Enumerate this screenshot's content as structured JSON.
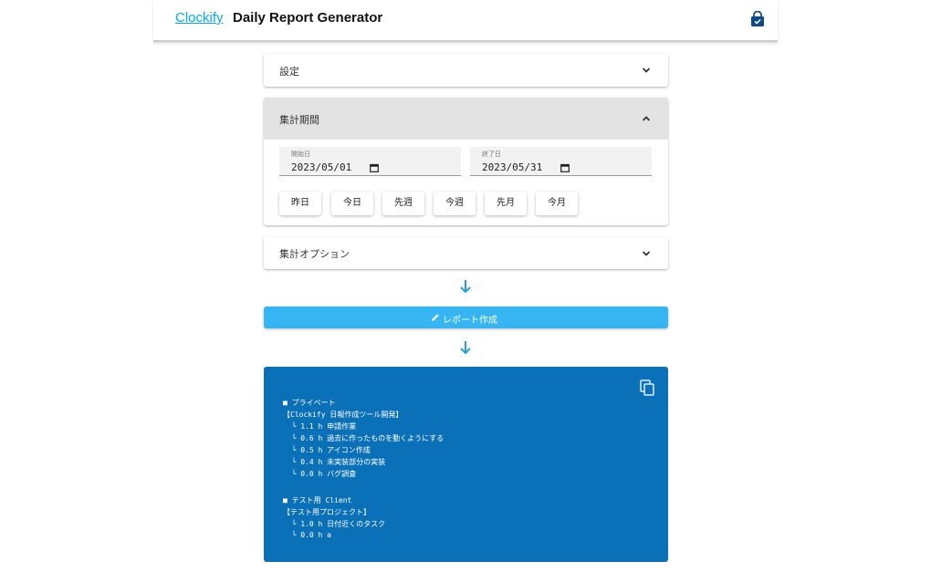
{
  "header": {
    "brand": "Clockify",
    "title": "Daily Report Generator",
    "icon": "shopping-bag-icon"
  },
  "sections": {
    "settings": {
      "label": "設定",
      "expanded": false
    },
    "period": {
      "label": "集計期間",
      "expanded": true
    },
    "options": {
      "label": "集計オプション",
      "expanded": false
    }
  },
  "period": {
    "start_label": "開始日",
    "start_value": "2023/05/01",
    "end_label": "終了日",
    "end_value": "2023/05/31",
    "quick_buttons": [
      "昨日",
      "今日",
      "先週",
      "今週",
      "先月",
      "今月"
    ]
  },
  "generate": {
    "label": "レポート作成",
    "icon": "pencil-icon"
  },
  "report": {
    "background": "#0a70b8",
    "lines": [
      "■ プライベート",
      "【Clockify 日報作成ツール開発】",
      "  └ 1.1 h 申請作業",
      "  └ 0.6 h 過去に作ったものを動くようにする",
      "  └ 0.5 h アイコン作成",
      "  └ 0.4 h 未実装部分の実装",
      "  └ 0.0 h バグ調査",
      "■ テスト用 Client",
      "【テスト用プロジェクト】",
      "  └ 1.0 h 日付近くのタスク",
      "  └ 0.0 h a"
    ]
  },
  "colors": {
    "accent": "#03a9f4",
    "button": "#35b6f2",
    "report": "#0a70b8",
    "brand_icon": "#0b4a8b"
  }
}
